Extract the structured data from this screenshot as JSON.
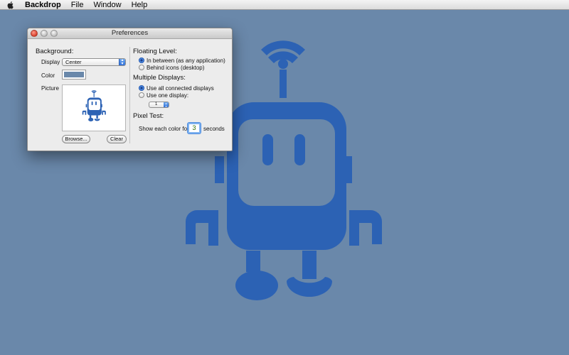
{
  "menubar": {
    "apple_icon": "apple-logo-icon",
    "app_name": "Backdrop",
    "items": [
      "File",
      "Window",
      "Help"
    ]
  },
  "colors": {
    "desktop_background": "#6a88aa",
    "robot_blue": "#2c62b4",
    "window_background": "#ececec"
  },
  "window": {
    "title": "Preferences",
    "background": {
      "heading": "Background:",
      "display_label": "Display",
      "display_value": "Center",
      "color_label": "Color",
      "color_value": "#6a88aa",
      "picture_label": "Picture",
      "browse_button": "Browse...",
      "clear_button": "Clear"
    },
    "floating_level": {
      "heading": "Floating Level:",
      "options": [
        "In between (as any application)",
        "Behind icons (desktop)"
      ],
      "selected": 0
    },
    "multiple_displays": {
      "heading": "Multiple Displays:",
      "options": [
        "Use all connected displays",
        "Use one display:"
      ],
      "selected": 0,
      "display_number": "1"
    },
    "pixel_test": {
      "heading": "Pixel Test:",
      "prefix": "Show each color for",
      "value": "3",
      "suffix": "seconds"
    }
  }
}
